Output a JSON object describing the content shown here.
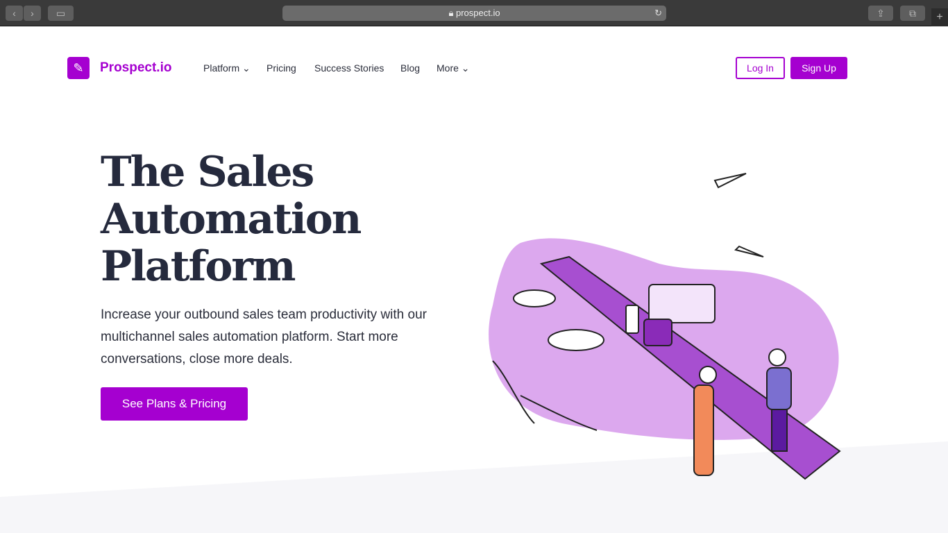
{
  "browser": {
    "url": "prospect.io",
    "back_icon": "chevron-left-icon",
    "forward_icon": "chevron-right-icon",
    "sidebar_icon": "sidebar-icon",
    "lock_icon": "lock-icon",
    "reload_icon": "reload-icon",
    "share_icon": "share-icon",
    "tabs_icon": "tabs-icon",
    "new_tab": "+"
  },
  "nav": {
    "brand": "Prospect.io",
    "items": [
      {
        "label": "Platform ⌄"
      },
      {
        "label": "Pricing"
      },
      {
        "label": "Success Stories"
      },
      {
        "label": "Blog"
      },
      {
        "label": "More ⌄"
      }
    ],
    "login": "Log In",
    "signup": "Sign Up"
  },
  "hero": {
    "title": "The Sales Automation Platform",
    "subtitle": "Increase your outbound sales team productivity with our multichannel sales automation platform. Start more conversations, close more deals.",
    "cta": "See Plans & Pricing"
  },
  "colors": {
    "brand": "#a500d0",
    "text": "#252a3d",
    "blob": "#dca8ee"
  }
}
